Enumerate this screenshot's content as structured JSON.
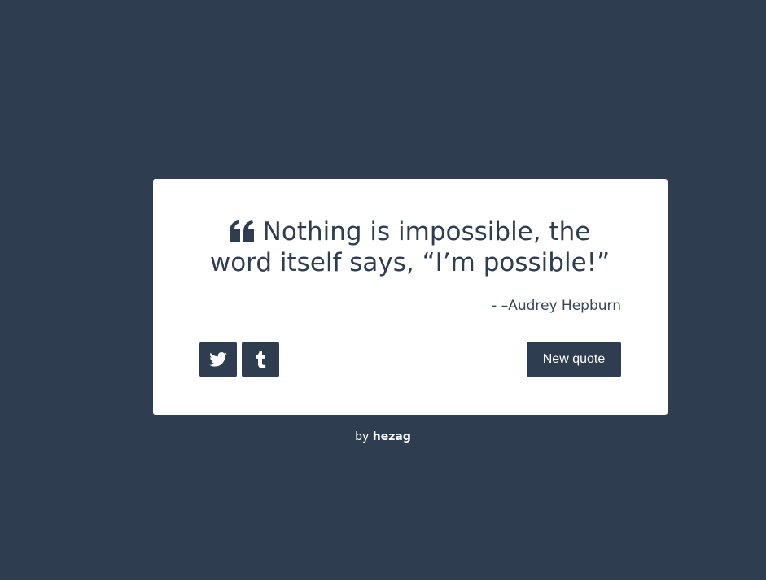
{
  "quote": {
    "text": "Nothing is impossible, the word itself says, “I’m possible!”",
    "author": "- –Audrey Hepburn",
    "icon": "quote-left-icon"
  },
  "actions": {
    "twitter_icon": "twitter-icon",
    "tumblr_icon": "tumblr-icon",
    "new_quote_label": "New quote"
  },
  "footer": {
    "prefix": "by",
    "author": "hezag"
  },
  "colors": {
    "background": "#2e3d50",
    "card": "#ffffff",
    "accent": "#2e3d50"
  }
}
